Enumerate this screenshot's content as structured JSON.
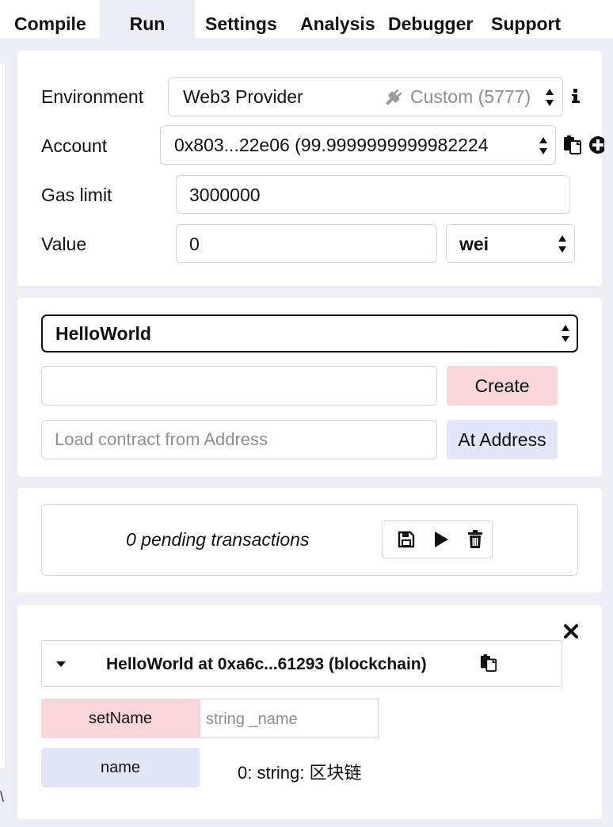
{
  "tabs": [
    {
      "label": "Compile"
    },
    {
      "label": "Run"
    },
    {
      "label": "Settings"
    },
    {
      "label": "Analysis"
    },
    {
      "label": "Debugger"
    },
    {
      "label": "Support"
    }
  ],
  "settings": {
    "environment_label": "Environment",
    "environment_value": "Web3 Provider",
    "environment_network": "Custom (5777)",
    "account_label": "Account",
    "account_value": "0x803...22e06 (99.9999999999982224",
    "gas_limit_label": "Gas limit",
    "gas_limit_value": "3000000",
    "value_label": "Value",
    "value_value": "0",
    "value_unit": "wei"
  },
  "contract": {
    "selected": "HelloWorld",
    "constructor_args": "",
    "create_label": "Create",
    "load_placeholder": "Load contract from Address",
    "at_address_label": "At Address"
  },
  "pending": {
    "text": "0 pending transactions"
  },
  "instance": {
    "title": "HelloWorld at 0xa6c...61293 (blockchain)",
    "setname_label": "setName",
    "setname_placeholder": "string _name",
    "name_label": "name",
    "name_result": "0: string: 区块链"
  },
  "colors": {
    "accent_pink": "#f8d7da",
    "accent_blue": "#e3e6f8",
    "background": "#edeef5"
  }
}
